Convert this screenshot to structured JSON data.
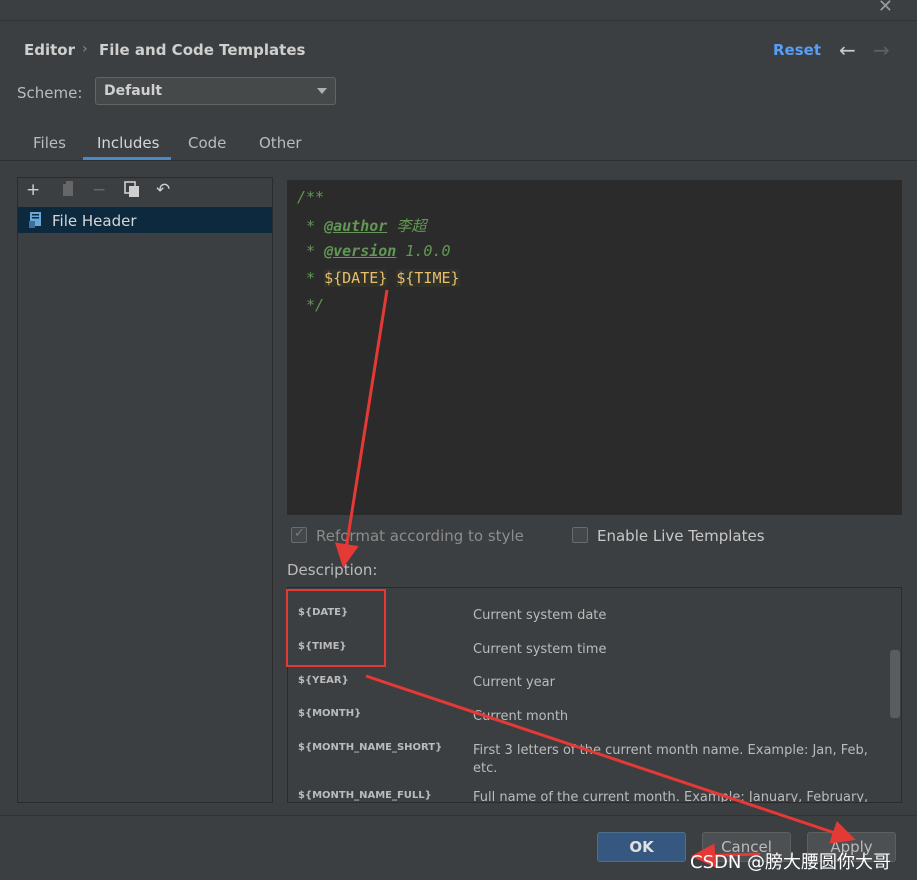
{
  "header": {
    "breadcrumb": [
      "Editor",
      "File and Code Templates"
    ],
    "reset_label": "Reset"
  },
  "scheme": {
    "label": "Scheme:",
    "value": "Default"
  },
  "tabs": [
    {
      "label": "Files"
    },
    {
      "label": "Includes",
      "active": true
    },
    {
      "label": "Code"
    },
    {
      "label": "Other"
    }
  ],
  "templates": [
    {
      "label": "File Header",
      "selected": true
    }
  ],
  "editor": {
    "lines": [
      {
        "text": "/**"
      },
      {
        "prefix": " * ",
        "tag": "@author",
        "value": " 李超"
      },
      {
        "prefix": " * ",
        "tag": "@version",
        "value": " 1.0.0"
      },
      {
        "prefix": " * ",
        "var1": "${DATE}",
        "var2": "${TIME}"
      },
      {
        "text": " */"
      }
    ]
  },
  "options": {
    "reformat_label": "Reformat according to style",
    "reformat_checked": true,
    "live_label": "Enable Live Templates",
    "live_checked": false
  },
  "description": {
    "label": "Description:",
    "rows": [
      {
        "var": "${DATE}",
        "text": "Current system date"
      },
      {
        "var": "${TIME}",
        "text": "Current system time"
      },
      {
        "var": "${YEAR}",
        "text": "Current year"
      },
      {
        "var": "${MONTH}",
        "text": "Current month"
      },
      {
        "var": "${MONTH_NAME_SHORT}",
        "text": "First 3 letters of the current month name. Example: Jan, Feb, etc."
      },
      {
        "var": "${MONTH_NAME_FULL}",
        "text": "Full name of the current month. Example: January, February,"
      }
    ]
  },
  "buttons": {
    "ok": "OK",
    "cancel": "Cancel",
    "apply": "Apply"
  },
  "watermark": "CSDN @膀大腰圆你大哥",
  "colors": {
    "annotation": "#e53935",
    "accent": "#4a88c7",
    "link": "#589df6"
  }
}
